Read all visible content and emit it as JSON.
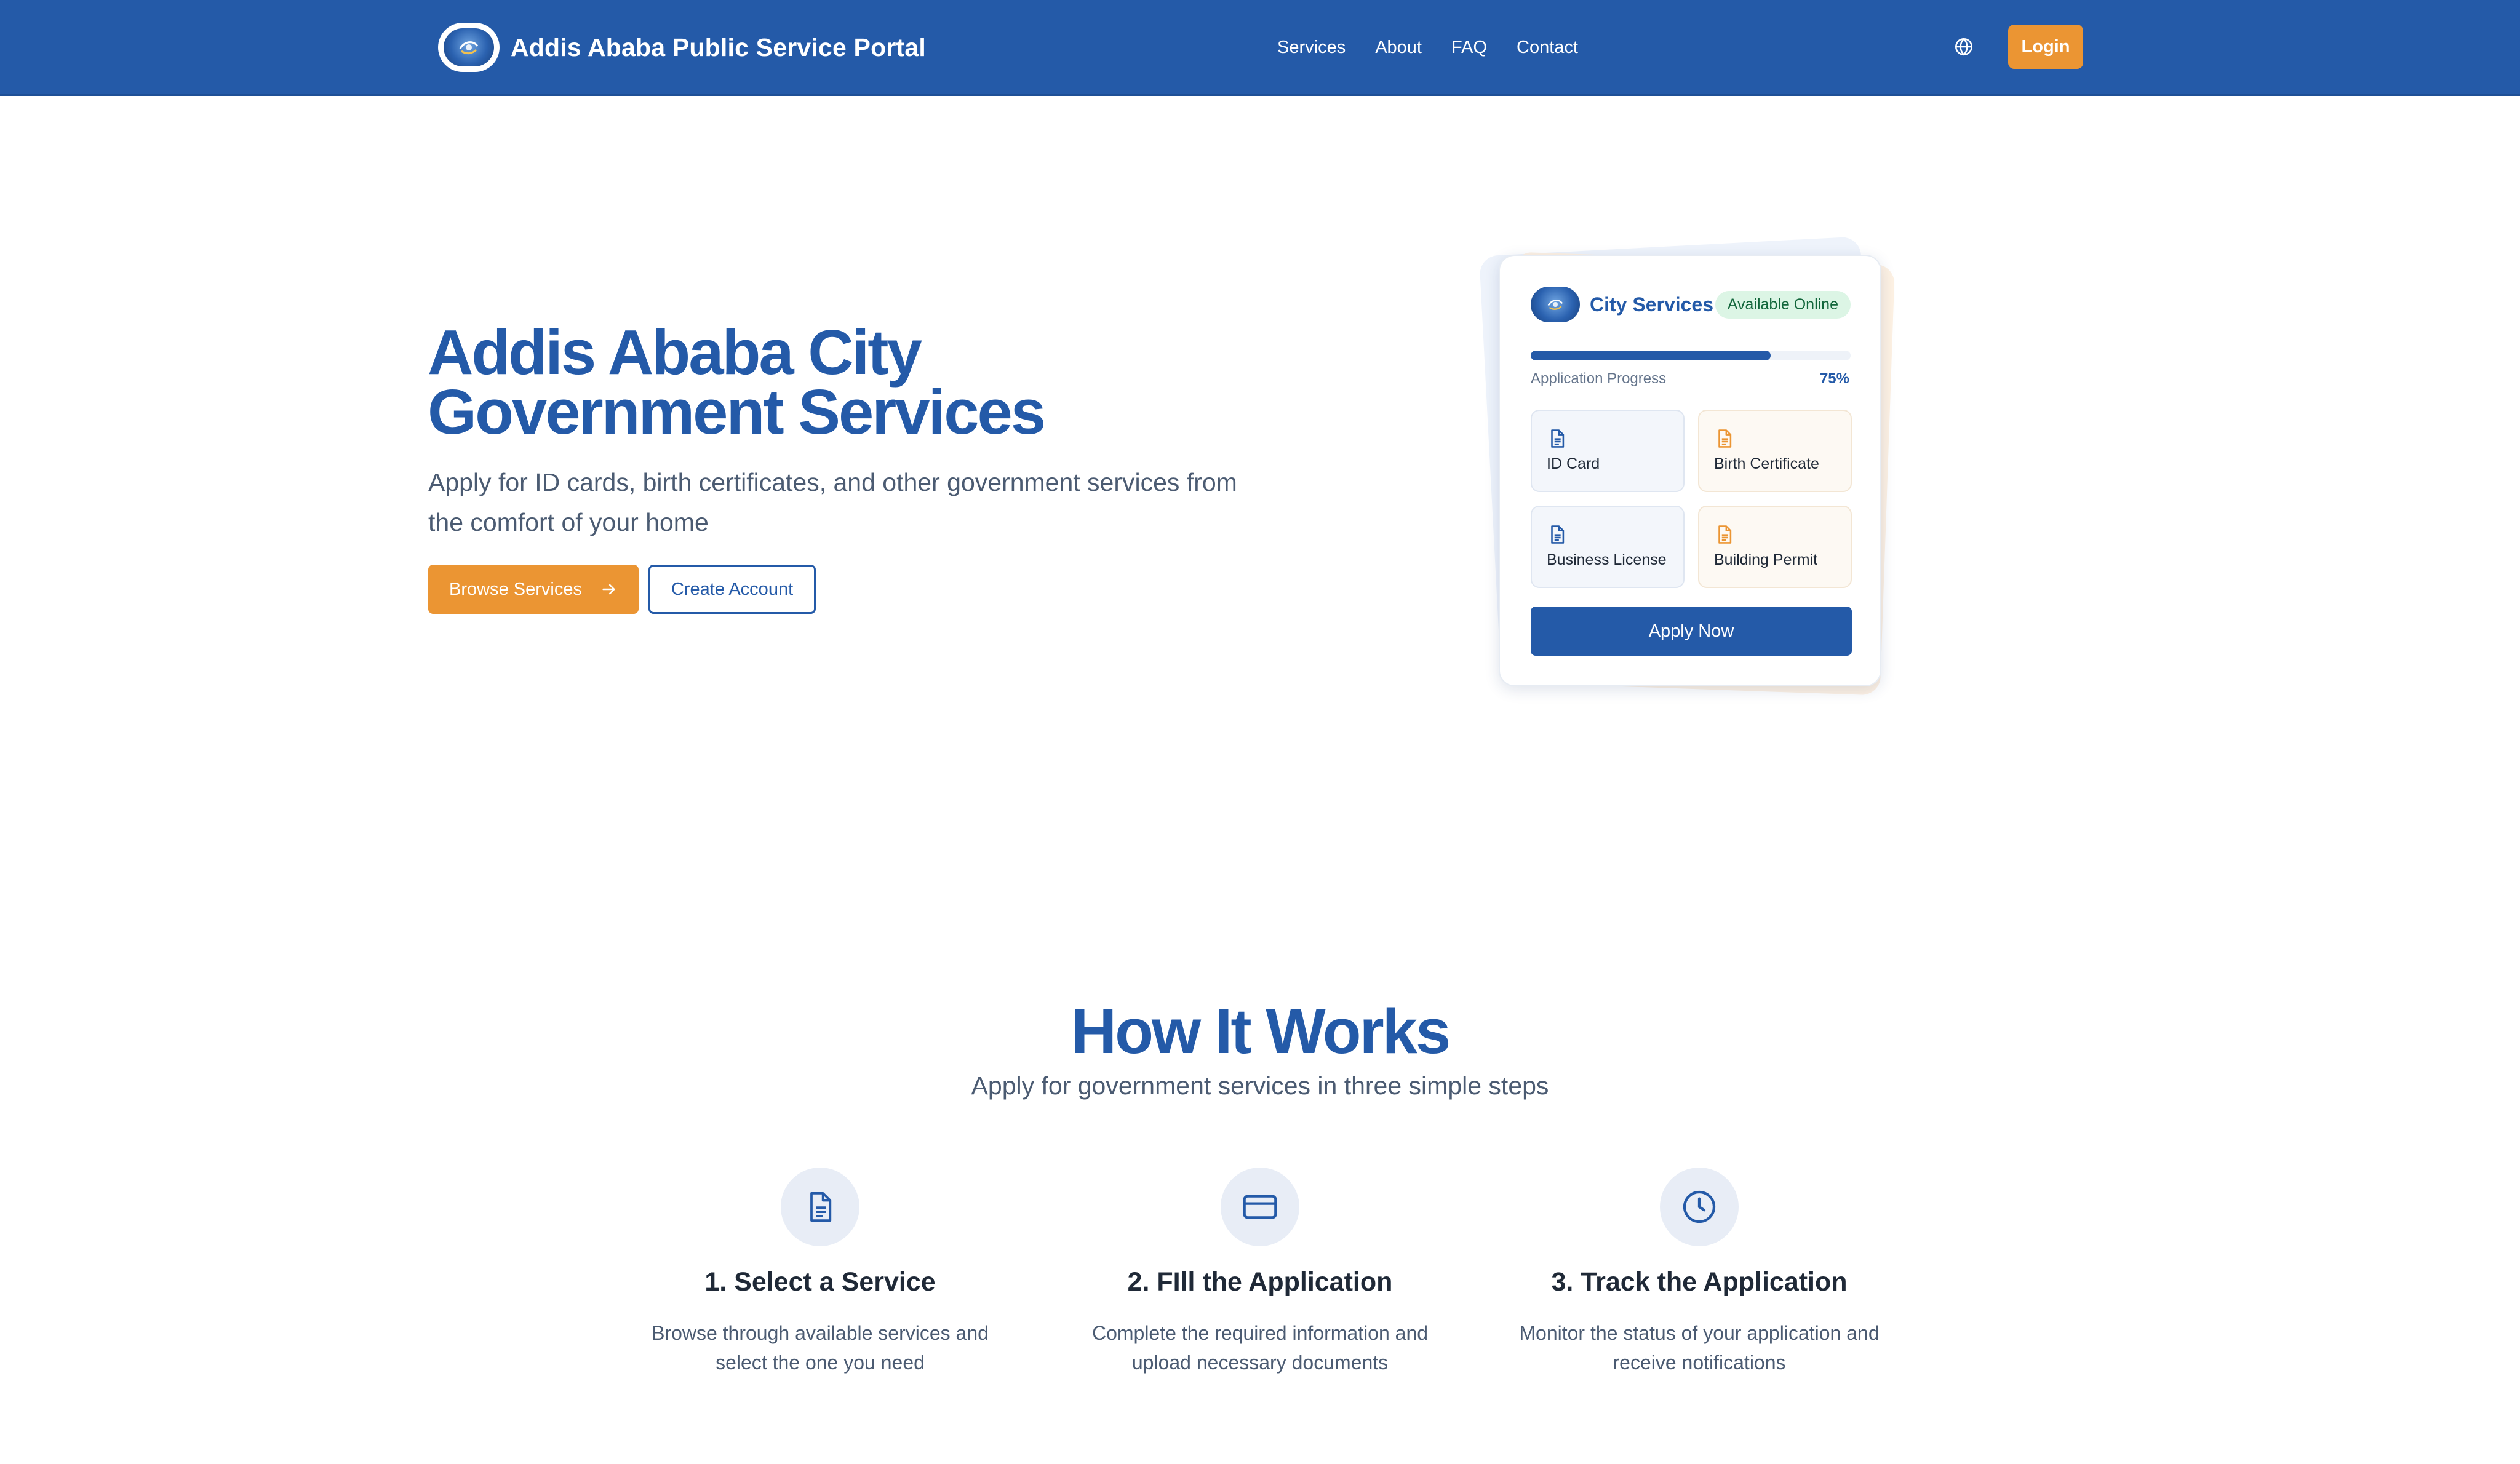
{
  "header": {
    "brand_title": "Addis Ababa Public Service Portal",
    "nav": [
      {
        "label": "Services"
      },
      {
        "label": "About"
      },
      {
        "label": "FAQ"
      },
      {
        "label": "Contact"
      }
    ],
    "language_icon": "globe-icon",
    "login_label": "Login"
  },
  "hero": {
    "title": "Addis Ababa City Government Services",
    "subtitle": "Apply for ID cards, birth certificates, and other government services from the comfort of your home",
    "primary_button": "Browse Services",
    "primary_button_icon": "arrow-right-icon",
    "secondary_button": "Create Account"
  },
  "card": {
    "title": "City Services",
    "badge": "Available Online",
    "progress_label": "Application Progress",
    "progress_value": "75%",
    "progress_fraction": 0.75,
    "tiles": [
      {
        "label": "ID Card",
        "icon": "document-icon",
        "tone": "blue"
      },
      {
        "label": "Birth Certificate",
        "icon": "document-icon",
        "tone": "orange"
      },
      {
        "label": "Business License",
        "icon": "document-icon",
        "tone": "blue"
      },
      {
        "label": "Building Permit",
        "icon": "document-icon",
        "tone": "orange"
      }
    ],
    "apply_button": "Apply Now"
  },
  "how_it_works": {
    "title": "How It Works",
    "subtitle": "Apply for government services in three simple steps",
    "steps": [
      {
        "title": "1. Select a Service",
        "description": "Browse through available services and select the one you need",
        "icon": "document-icon"
      },
      {
        "title": "2. FIll the Application",
        "description": "Complete the required information and upload necessary documents",
        "icon": "credit-card-icon"
      },
      {
        "title": "3. Track the Application",
        "description": "Monitor the status of your application and receive notifications",
        "icon": "clock-icon"
      }
    ]
  },
  "colors": {
    "primary": "#245aa8",
    "accent": "#eb9533",
    "badge_bg": "#dcf5e5",
    "badge_text": "#12663b"
  }
}
